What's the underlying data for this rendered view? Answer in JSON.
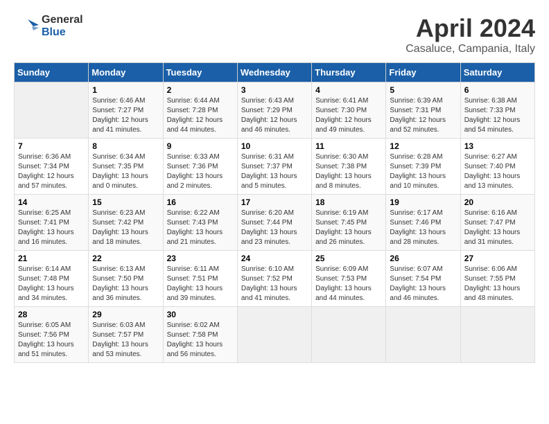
{
  "logo": {
    "general": "General",
    "blue": "Blue"
  },
  "title": "April 2024",
  "subtitle": "Casaluce, Campania, Italy",
  "days_of_week": [
    "Sunday",
    "Monday",
    "Tuesday",
    "Wednesday",
    "Thursday",
    "Friday",
    "Saturday"
  ],
  "weeks": [
    [
      {
        "day": "",
        "sunrise": "",
        "sunset": "",
        "daylight": ""
      },
      {
        "day": "1",
        "sunrise": "Sunrise: 6:46 AM",
        "sunset": "Sunset: 7:27 PM",
        "daylight": "Daylight: 12 hours and 41 minutes."
      },
      {
        "day": "2",
        "sunrise": "Sunrise: 6:44 AM",
        "sunset": "Sunset: 7:28 PM",
        "daylight": "Daylight: 12 hours and 44 minutes."
      },
      {
        "day": "3",
        "sunrise": "Sunrise: 6:43 AM",
        "sunset": "Sunset: 7:29 PM",
        "daylight": "Daylight: 12 hours and 46 minutes."
      },
      {
        "day": "4",
        "sunrise": "Sunrise: 6:41 AM",
        "sunset": "Sunset: 7:30 PM",
        "daylight": "Daylight: 12 hours and 49 minutes."
      },
      {
        "day": "5",
        "sunrise": "Sunrise: 6:39 AM",
        "sunset": "Sunset: 7:31 PM",
        "daylight": "Daylight: 12 hours and 52 minutes."
      },
      {
        "day": "6",
        "sunrise": "Sunrise: 6:38 AM",
        "sunset": "Sunset: 7:33 PM",
        "daylight": "Daylight: 12 hours and 54 minutes."
      }
    ],
    [
      {
        "day": "7",
        "sunrise": "Sunrise: 6:36 AM",
        "sunset": "Sunset: 7:34 PM",
        "daylight": "Daylight: 12 hours and 57 minutes."
      },
      {
        "day": "8",
        "sunrise": "Sunrise: 6:34 AM",
        "sunset": "Sunset: 7:35 PM",
        "daylight": "Daylight: 13 hours and 0 minutes."
      },
      {
        "day": "9",
        "sunrise": "Sunrise: 6:33 AM",
        "sunset": "Sunset: 7:36 PM",
        "daylight": "Daylight: 13 hours and 2 minutes."
      },
      {
        "day": "10",
        "sunrise": "Sunrise: 6:31 AM",
        "sunset": "Sunset: 7:37 PM",
        "daylight": "Daylight: 13 hours and 5 minutes."
      },
      {
        "day": "11",
        "sunrise": "Sunrise: 6:30 AM",
        "sunset": "Sunset: 7:38 PM",
        "daylight": "Daylight: 13 hours and 8 minutes."
      },
      {
        "day": "12",
        "sunrise": "Sunrise: 6:28 AM",
        "sunset": "Sunset: 7:39 PM",
        "daylight": "Daylight: 13 hours and 10 minutes."
      },
      {
        "day": "13",
        "sunrise": "Sunrise: 6:27 AM",
        "sunset": "Sunset: 7:40 PM",
        "daylight": "Daylight: 13 hours and 13 minutes."
      }
    ],
    [
      {
        "day": "14",
        "sunrise": "Sunrise: 6:25 AM",
        "sunset": "Sunset: 7:41 PM",
        "daylight": "Daylight: 13 hours and 16 minutes."
      },
      {
        "day": "15",
        "sunrise": "Sunrise: 6:23 AM",
        "sunset": "Sunset: 7:42 PM",
        "daylight": "Daylight: 13 hours and 18 minutes."
      },
      {
        "day": "16",
        "sunrise": "Sunrise: 6:22 AM",
        "sunset": "Sunset: 7:43 PM",
        "daylight": "Daylight: 13 hours and 21 minutes."
      },
      {
        "day": "17",
        "sunrise": "Sunrise: 6:20 AM",
        "sunset": "Sunset: 7:44 PM",
        "daylight": "Daylight: 13 hours and 23 minutes."
      },
      {
        "day": "18",
        "sunrise": "Sunrise: 6:19 AM",
        "sunset": "Sunset: 7:45 PM",
        "daylight": "Daylight: 13 hours and 26 minutes."
      },
      {
        "day": "19",
        "sunrise": "Sunrise: 6:17 AM",
        "sunset": "Sunset: 7:46 PM",
        "daylight": "Daylight: 13 hours and 28 minutes."
      },
      {
        "day": "20",
        "sunrise": "Sunrise: 6:16 AM",
        "sunset": "Sunset: 7:47 PM",
        "daylight": "Daylight: 13 hours and 31 minutes."
      }
    ],
    [
      {
        "day": "21",
        "sunrise": "Sunrise: 6:14 AM",
        "sunset": "Sunset: 7:48 PM",
        "daylight": "Daylight: 13 hours and 34 minutes."
      },
      {
        "day": "22",
        "sunrise": "Sunrise: 6:13 AM",
        "sunset": "Sunset: 7:50 PM",
        "daylight": "Daylight: 13 hours and 36 minutes."
      },
      {
        "day": "23",
        "sunrise": "Sunrise: 6:11 AM",
        "sunset": "Sunset: 7:51 PM",
        "daylight": "Daylight: 13 hours and 39 minutes."
      },
      {
        "day": "24",
        "sunrise": "Sunrise: 6:10 AM",
        "sunset": "Sunset: 7:52 PM",
        "daylight": "Daylight: 13 hours and 41 minutes."
      },
      {
        "day": "25",
        "sunrise": "Sunrise: 6:09 AM",
        "sunset": "Sunset: 7:53 PM",
        "daylight": "Daylight: 13 hours and 44 minutes."
      },
      {
        "day": "26",
        "sunrise": "Sunrise: 6:07 AM",
        "sunset": "Sunset: 7:54 PM",
        "daylight": "Daylight: 13 hours and 46 minutes."
      },
      {
        "day": "27",
        "sunrise": "Sunrise: 6:06 AM",
        "sunset": "Sunset: 7:55 PM",
        "daylight": "Daylight: 13 hours and 48 minutes."
      }
    ],
    [
      {
        "day": "28",
        "sunrise": "Sunrise: 6:05 AM",
        "sunset": "Sunset: 7:56 PM",
        "daylight": "Daylight: 13 hours and 51 minutes."
      },
      {
        "day": "29",
        "sunrise": "Sunrise: 6:03 AM",
        "sunset": "Sunset: 7:57 PM",
        "daylight": "Daylight: 13 hours and 53 minutes."
      },
      {
        "day": "30",
        "sunrise": "Sunrise: 6:02 AM",
        "sunset": "Sunset: 7:58 PM",
        "daylight": "Daylight: 13 hours and 56 minutes."
      },
      {
        "day": "",
        "sunrise": "",
        "sunset": "",
        "daylight": ""
      },
      {
        "day": "",
        "sunrise": "",
        "sunset": "",
        "daylight": ""
      },
      {
        "day": "",
        "sunrise": "",
        "sunset": "",
        "daylight": ""
      },
      {
        "day": "",
        "sunrise": "",
        "sunset": "",
        "daylight": ""
      }
    ]
  ]
}
